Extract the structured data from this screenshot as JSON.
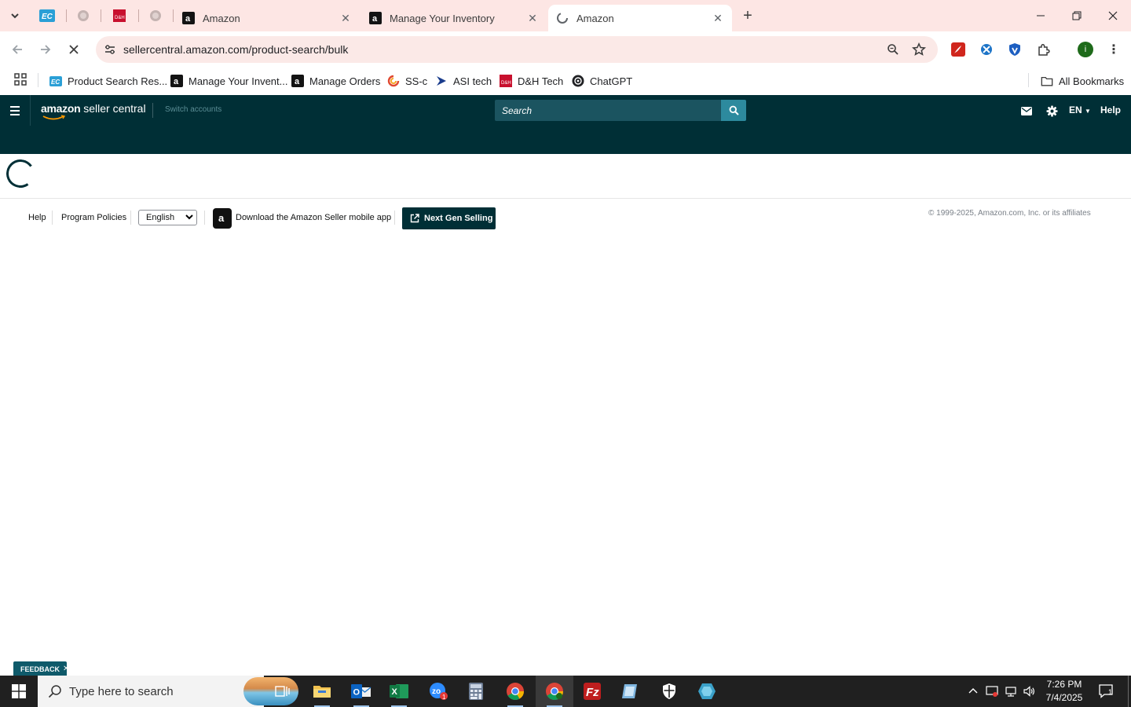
{
  "browser": {
    "tabs": [
      {
        "title": "Amazon",
        "favicon": "amazon-a-icon",
        "active": false
      },
      {
        "title": "Manage Your Inventory",
        "favicon": "amazon-a-icon",
        "active": false
      },
      {
        "title": "Amazon",
        "favicon": "loading-icon",
        "active": true
      }
    ],
    "close_glyph": "✕",
    "url": "sellercentral.amazon.com/product-search/bulk",
    "profile_initial": "i",
    "bookmarks": [
      {
        "label": "Product Search Res...",
        "favicon": "ec-icon"
      },
      {
        "label": "Manage Your Invent...",
        "favicon": "amazon-a-icon"
      },
      {
        "label": "Manage Orders",
        "favicon": "amazon-a-icon"
      },
      {
        "label": "SS-c",
        "favicon": "ss-icon"
      },
      {
        "label": "ASI tech",
        "favicon": "asi-icon"
      },
      {
        "label": "D&H Tech",
        "favicon": "dh-icon"
      },
      {
        "label": "ChatGPT",
        "favicon": "chatgpt-icon"
      }
    ],
    "all_bookmarks": "All Bookmarks"
  },
  "seller_central": {
    "logo_bold": "amazon",
    "logo_rest": " seller central",
    "switch_accounts": "Switch accounts",
    "search_placeholder": "Search",
    "language": "EN",
    "help": "Help"
  },
  "footer": {
    "help": "Help",
    "program_policies": "Program Policies",
    "language_select": "English",
    "download_app": "Download the Amazon Seller mobile app",
    "next_gen": "Next Gen Selling",
    "copyright": "© 1999-2025, Amazon.com, Inc. or its affiliates"
  },
  "feedback": {
    "label": "FEEDBACK",
    "close": "✕"
  },
  "taskbar": {
    "search_placeholder": "Type here to search",
    "time": "7:26 PM",
    "date": "7/4/2025",
    "notification_count": "1",
    "zoom_badge": "1"
  },
  "colors": {
    "tabstrip_bg": "#fde6e4",
    "seller_header": "#002f36",
    "search_button": "#2d8a9e",
    "taskbar_bg": "#202020"
  }
}
